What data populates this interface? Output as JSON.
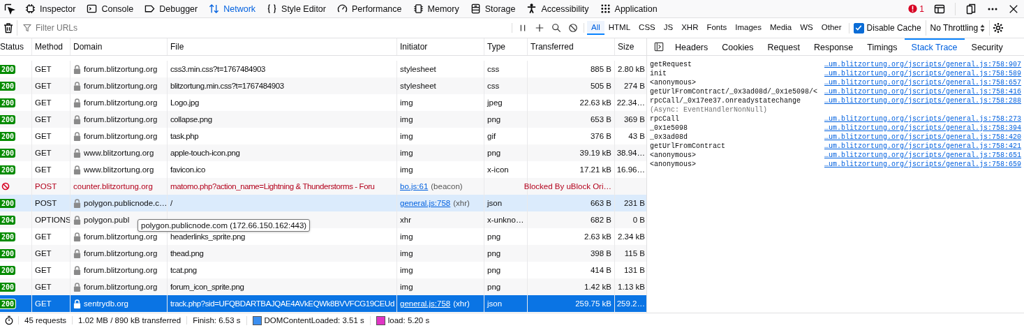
{
  "toolbar": {
    "tabs": [
      {
        "label": "Inspector",
        "selected": false
      },
      {
        "label": "Console",
        "selected": false
      },
      {
        "label": "Debugger",
        "selected": false
      },
      {
        "label": "Network",
        "selected": true
      },
      {
        "label": "Style Editor",
        "selected": false
      },
      {
        "label": "Performance",
        "selected": false
      },
      {
        "label": "Memory",
        "selected": false
      },
      {
        "label": "Storage",
        "selected": false
      },
      {
        "label": "Accessibility",
        "selected": false
      },
      {
        "label": "Application",
        "selected": false
      }
    ],
    "error_count": "1"
  },
  "filter_bar": {
    "placeholder": "Filter URLs",
    "type_filters": [
      {
        "label": "All",
        "selected": true
      },
      {
        "label": "HTML",
        "selected": false
      },
      {
        "label": "CSS",
        "selected": false
      },
      {
        "label": "JS",
        "selected": false
      },
      {
        "label": "XHR",
        "selected": false
      },
      {
        "label": "Fonts",
        "selected": false
      },
      {
        "label": "Images",
        "selected": false
      },
      {
        "label": "Media",
        "selected": false
      },
      {
        "label": "WS",
        "selected": false
      },
      {
        "label": "Other",
        "selected": false
      }
    ],
    "disable_cache": {
      "label": "Disable Cache",
      "checked": true
    },
    "throttling": "No Throttling"
  },
  "table": {
    "columns": [
      "Status",
      "Method",
      "Domain",
      "File",
      "Initiator",
      "Type",
      "Transferred",
      "Size"
    ],
    "rows": [
      {
        "kind": "ok",
        "status": "200",
        "method": "GET",
        "secure": true,
        "domain": "forum.blitzortung.org",
        "file": "css3.min.css?t=1767484903",
        "initiator": "stylesheet",
        "type": "css",
        "transferred": "885 B",
        "size": "2.80 kB",
        "selected": false,
        "hovered": false
      },
      {
        "kind": "ok",
        "status": "200",
        "method": "GET",
        "secure": true,
        "domain": "forum.blitzortung.org",
        "file": "blitzortung.min.css?t=1767484903",
        "initiator": "stylesheet",
        "type": "css",
        "transferred": "505 B",
        "size": "274 B",
        "selected": false,
        "hovered": false
      },
      {
        "kind": "ok",
        "status": "200",
        "method": "GET",
        "secure": true,
        "domain": "forum.blitzortung.org",
        "file": "Logo.jpg",
        "initiator": "img",
        "type": "jpeg",
        "transferred": "22.63 kB",
        "size": "22.34…",
        "selected": false,
        "hovered": false
      },
      {
        "kind": "ok",
        "status": "200",
        "method": "GET",
        "secure": true,
        "domain": "forum.blitzortung.org",
        "file": "collapse.png",
        "initiator": "img",
        "type": "png",
        "transferred": "653 B",
        "size": "369 B",
        "selected": false,
        "hovered": false
      },
      {
        "kind": "ok",
        "status": "200",
        "method": "GET",
        "secure": true,
        "domain": "forum.blitzortung.org",
        "file": "task.php",
        "initiator": "img",
        "type": "gif",
        "transferred": "376 B",
        "size": "43 B",
        "selected": false,
        "hovered": false
      },
      {
        "kind": "ok",
        "status": "200",
        "method": "GET",
        "secure": true,
        "domain": "www.blitzortung.org",
        "file": "apple-touch-icon.png",
        "initiator": "img",
        "type": "png",
        "transferred": "39.19 kB",
        "size": "38.94…",
        "selected": false,
        "hovered": false
      },
      {
        "kind": "ok",
        "status": "200",
        "method": "GET",
        "secure": true,
        "domain": "www.blitzortung.org",
        "file": "favicon.ico",
        "initiator": "img",
        "type": "x-icon",
        "transferred": "17.21 kB",
        "size": "16.96…",
        "selected": false,
        "hovered": false
      },
      {
        "kind": "blocked",
        "method": "POST",
        "secure": false,
        "domain": "counter.blitzortung.org",
        "file": "matomo.php?action_name=Lightning & Thunderstorms - Foru",
        "initiator_link": "bo.js:61",
        "initiator": "(beacon)",
        "transferred": "Blocked By uBlock Ori…",
        "selected": false,
        "hovered": false
      },
      {
        "kind": "ok",
        "status": "200",
        "method": "POST",
        "secure": true,
        "domain": "polygon.publicnode.c…",
        "file": "/",
        "initiator_link": "general.js:758",
        "initiator": "(xhr)",
        "type": "json",
        "transferred": "663 B",
        "size": "231 B",
        "selected": false,
        "hovered": true
      },
      {
        "kind": "ok",
        "status": "204",
        "method": "OPTIONS",
        "secure": true,
        "domain": "polygon.publ",
        "initiator": "xhr",
        "type": "x-unkno…",
        "transferred": "682 B",
        "size": "0 B",
        "selected": false,
        "hovered": false
      },
      {
        "kind": "ok",
        "status": "200",
        "method": "GET",
        "secure": true,
        "domain": "forum.blitzortung.org",
        "file": "headerlinks_sprite.png",
        "initiator": "img",
        "type": "png",
        "transferred": "2.63 kB",
        "size": "2.34 kB",
        "selected": false,
        "hovered": false
      },
      {
        "kind": "ok",
        "status": "200",
        "method": "GET",
        "secure": true,
        "domain": "forum.blitzortung.org",
        "file": "thead.png",
        "initiator": "img",
        "type": "png",
        "transferred": "398 B",
        "size": "115 B",
        "selected": false,
        "hovered": false
      },
      {
        "kind": "ok",
        "status": "200",
        "method": "GET",
        "secure": true,
        "domain": "forum.blitzortung.org",
        "file": "tcat.png",
        "initiator": "img",
        "type": "png",
        "transferred": "414 B",
        "size": "131 B",
        "selected": false,
        "hovered": false
      },
      {
        "kind": "ok",
        "status": "200",
        "method": "GET",
        "secure": true,
        "domain": "forum.blitzortung.org",
        "file": "forum_icon_sprite.png",
        "initiator": "img",
        "type": "png",
        "transferred": "1.42 kB",
        "size": "1.13 kB",
        "selected": false,
        "hovered": false
      },
      {
        "kind": "ok",
        "status": "200",
        "method": "GET",
        "secure": true,
        "domain": "sentrydb.org",
        "file": "track.php?sid=UFQBDARTBAJQAE4AVkEQWk8BVVFCG19CEUd",
        "initiator_link": "general.js:758",
        "initiator": "(xhr)",
        "type": "json",
        "transferred": "259.75 kB",
        "size": "259.2…",
        "selected": true,
        "hovered": false
      }
    ],
    "tooltip": "polygon.publicnode.com (172.66.150.162:443)"
  },
  "details": {
    "tabs": [
      {
        "label": "Headers",
        "selected": false
      },
      {
        "label": "Cookies",
        "selected": false
      },
      {
        "label": "Request",
        "selected": false
      },
      {
        "label": "Response",
        "selected": false
      },
      {
        "label": "Timings",
        "selected": false
      },
      {
        "label": "Stack Trace",
        "selected": true
      },
      {
        "label": "Security",
        "selected": false
      }
    ],
    "stack": [
      {
        "kind": "frame",
        "function": "getRequest",
        "link": "…um.blitzortung.org/jscripts/general.js:758:907"
      },
      {
        "kind": "frame",
        "function": "init",
        "link": "…um.blitzortung.org/jscripts/general.js:758:589"
      },
      {
        "kind": "frame",
        "function": "<anonymous>",
        "link": "…um.blitzortung.org/jscripts/general.js:758:657"
      },
      {
        "kind": "frame",
        "function": "getUrlFromContract/_0x3ad08d/_0x1e5098/<",
        "link": "…um.blitzortung.org/jscripts/general.js:758:416"
      },
      {
        "kind": "frame",
        "function": "rpcCall/_0x17ee37.onreadystatechange",
        "link": "…um.blitzortung.org/jscripts/general.js:758:288"
      },
      {
        "kind": "async",
        "function": "(Async: EventHandlerNonNull)"
      },
      {
        "kind": "frame",
        "function": "rpcCall",
        "link": "…um.blitzortung.org/jscripts/general.js:758:273"
      },
      {
        "kind": "frame",
        "function": "_0x1e5098",
        "link": "…um.blitzortung.org/jscripts/general.js:758:394"
      },
      {
        "kind": "frame",
        "function": "_0x3ad08d",
        "link": "…um.blitzortung.org/jscripts/general.js:758:420"
      },
      {
        "kind": "frame",
        "function": "getUrlFromContract",
        "link": "…um.blitzortung.org/jscripts/general.js:758:421"
      },
      {
        "kind": "frame",
        "function": "<anonymous>",
        "link": "…um.blitzortung.org/jscripts/general.js:758:651"
      },
      {
        "kind": "frame",
        "function": "<anonymous>",
        "link": "…um.blitzortung.org/jscripts/general.js:758:659"
      }
    ]
  },
  "status_bar": [
    {
      "text": "45 requests"
    },
    {
      "text": "1.02 MB / 890 kB transferred"
    },
    {
      "text": "Finish: 6.53 s"
    },
    {
      "text": "DOMContentLoaded: 3.51 s",
      "color": "#3a8ef0"
    },
    {
      "text": "load: 5.20 s",
      "color": "#e034c4"
    }
  ]
}
